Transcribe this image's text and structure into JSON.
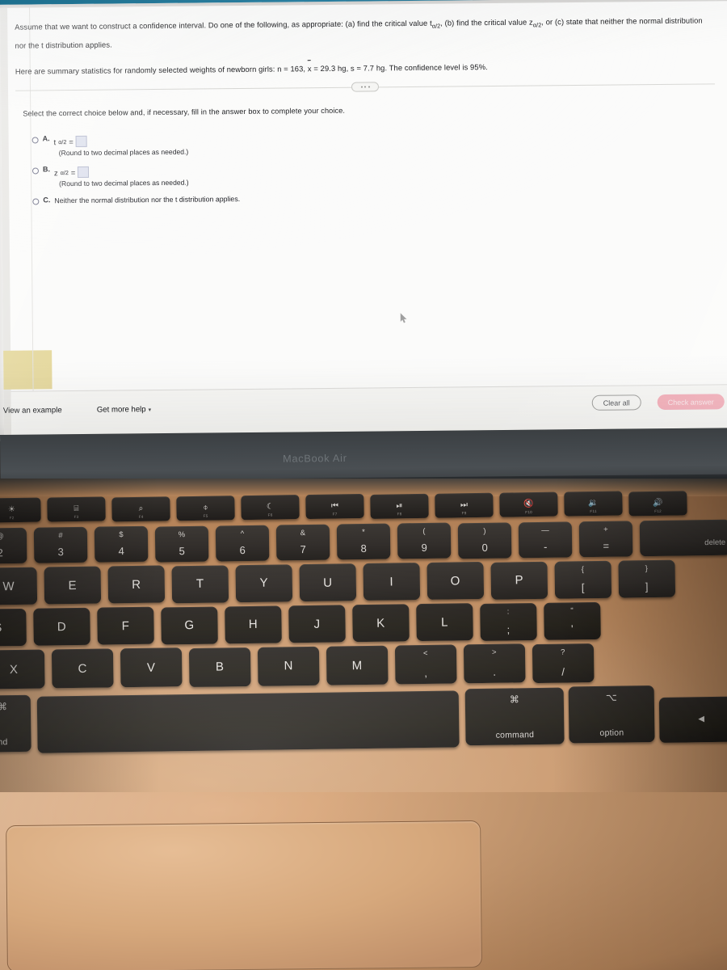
{
  "photo": {
    "device_label": "MacBook Air"
  },
  "screen": {
    "problem": {
      "line1_a": "Assume that we want to construct a confidence interval. Do one of the following, as appropriate: (a) find the critical value t",
      "line1_sub1": "α/2",
      "line1_b": ", (b) find the critical value z",
      "line1_sub2": "α/2",
      "line1_c": ", or (c) state that neither the normal distribution nor the t distribution applies.",
      "line2_a": "Here are summary statistics for randomly selected weights of newborn girls: n = 163, ",
      "line2_xbar": "x",
      "line2_b": " = 29.3 hg, s = 7.7 hg. The confidence level is 95%."
    },
    "instruction": "Select the correct choice below and, if necessary, fill in the answer box to complete your choice.",
    "choices": [
      {
        "letter": "A.",
        "symbol": "t",
        "subscript": "α/2",
        "equals": "=",
        "answer_value": "",
        "hint": "(Round to two decimal places as needed.)",
        "has_box": true
      },
      {
        "letter": "B.",
        "symbol": "z",
        "subscript": "α/2",
        "equals": "=",
        "answer_value": "",
        "hint": "(Round to two decimal places as needed.)",
        "has_box": true
      },
      {
        "letter": "C.",
        "text": "Neither the normal distribution nor the t distribution applies.",
        "has_box": false
      }
    ],
    "toolbar": {
      "view_example": "View an example",
      "get_more_help": "Get more help",
      "get_more_help_caret": "▾",
      "clear_all": "Clear all",
      "check_answer": "Check answer"
    },
    "colors": {
      "page_background": "#fbfbfa",
      "answer_box_fill": "#dfe2ee",
      "check_answer_button": "#f4aab6",
      "clear_all_border": "#9a9a98",
      "tan_swatch": "#e4d79b",
      "top_band_teal": "#1d6f8e"
    }
  },
  "keyboard": {
    "function_row": [
      {
        "glyph": "☀",
        "label": "F2",
        "name": "brightness-down-key"
      },
      {
        "glyph": "⌸",
        "label": "F3",
        "name": "mission-control-key"
      },
      {
        "glyph": "⌕",
        "label": "F4",
        "name": "spotlight-key"
      },
      {
        "glyph": "⌽",
        "label": "F5",
        "name": "dictation-key"
      },
      {
        "glyph": "☾",
        "label": "F6",
        "name": "do-not-disturb-key"
      },
      {
        "glyph": "⏮",
        "label": "F7",
        "name": "previous-track-key"
      },
      {
        "glyph": "⏯",
        "label": "F8",
        "name": "play-pause-key"
      },
      {
        "glyph": "⏭",
        "label": "F9",
        "name": "next-track-key"
      },
      {
        "glyph": "🔇",
        "label": "F10",
        "name": "mute-key"
      },
      {
        "glyph": "🔉",
        "label": "F11",
        "name": "volume-down-key"
      },
      {
        "glyph": "🔊",
        "label": "F12",
        "name": "volume-up-key"
      }
    ],
    "number_row": [
      {
        "top": "@",
        "bot": "2",
        "name": "key-2",
        "partial": true
      },
      {
        "top": "#",
        "bot": "3",
        "name": "key-3"
      },
      {
        "top": "$",
        "bot": "4",
        "name": "key-4"
      },
      {
        "top": "%",
        "bot": "5",
        "name": "key-5"
      },
      {
        "top": "^",
        "bot": "6",
        "name": "key-6"
      },
      {
        "top": "&",
        "bot": "7",
        "name": "key-7"
      },
      {
        "top": "*",
        "bot": "8",
        "name": "key-8"
      },
      {
        "top": "(",
        "bot": "9",
        "name": "key-9"
      },
      {
        "top": ")",
        "bot": "0",
        "name": "key-0"
      },
      {
        "top": "—",
        "bot": "-",
        "name": "key-minus"
      },
      {
        "top": "+",
        "bot": "=",
        "name": "key-equals"
      }
    ],
    "delete_key": "delete",
    "qwerty_row": [
      {
        "label": "W",
        "name": "key-w",
        "partial": true
      },
      {
        "label": "E",
        "name": "key-e"
      },
      {
        "label": "R",
        "name": "key-r"
      },
      {
        "label": "T",
        "name": "key-t"
      },
      {
        "label": "Y",
        "name": "key-y"
      },
      {
        "label": "U",
        "name": "key-u"
      },
      {
        "label": "I",
        "name": "key-i"
      },
      {
        "label": "O",
        "name": "key-o"
      },
      {
        "label": "P",
        "name": "key-p"
      },
      {
        "top": "{",
        "bot": "[",
        "name": "key-left-bracket"
      },
      {
        "top": "}",
        "bot": "]",
        "name": "key-right-bracket"
      }
    ],
    "home_row": [
      {
        "label": "S",
        "name": "key-s",
        "partial": true
      },
      {
        "label": "D",
        "name": "key-d"
      },
      {
        "label": "F",
        "name": "key-f"
      },
      {
        "label": "G",
        "name": "key-g"
      },
      {
        "label": "H",
        "name": "key-h"
      },
      {
        "label": "J",
        "name": "key-j"
      },
      {
        "label": "K",
        "name": "key-k"
      },
      {
        "label": "L",
        "name": "key-l"
      },
      {
        "top": ":",
        "bot": ";",
        "name": "key-semicolon"
      },
      {
        "top": "\"",
        "bot": "'",
        "name": "key-quote"
      }
    ],
    "bottom_row": [
      {
        "label": "X",
        "name": "key-x",
        "partial": true
      },
      {
        "label": "C",
        "name": "key-c"
      },
      {
        "label": "V",
        "name": "key-v"
      },
      {
        "label": "B",
        "name": "key-b"
      },
      {
        "label": "N",
        "name": "key-n"
      },
      {
        "label": "M",
        "name": "key-m"
      },
      {
        "top": "<",
        "bot": ",",
        "name": "key-comma"
      },
      {
        "top": ">",
        "bot": ".",
        "name": "key-period"
      },
      {
        "top": "?",
        "bot": "/",
        "name": "key-slash"
      }
    ],
    "modifier_row": {
      "left_command_symbol": "⌘",
      "left_command_word": "nd",
      "space_bar": "",
      "right_command_symbol": "⌘",
      "right_command_word": "command",
      "option_symbol": "⌥",
      "option_word": "option",
      "arrow_left": "◀"
    }
  }
}
